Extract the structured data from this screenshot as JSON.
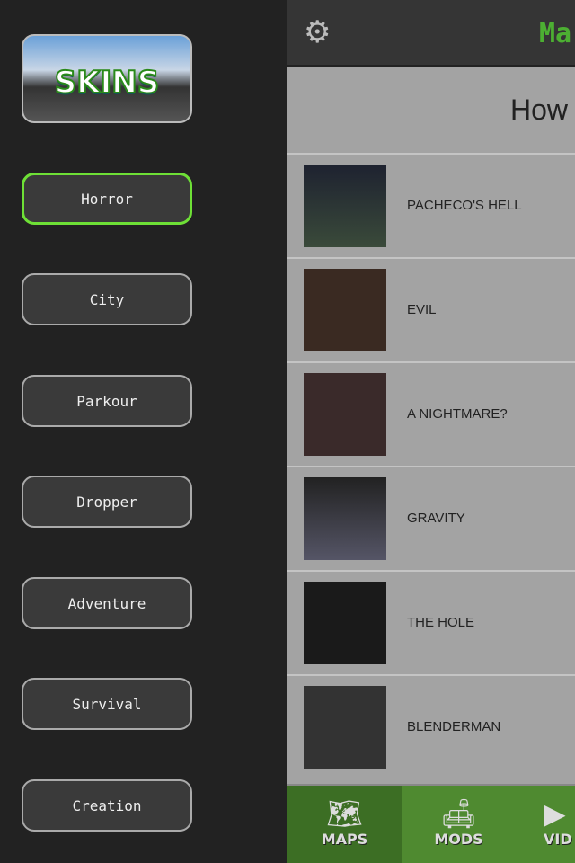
{
  "sidebar": {
    "logo_text": "SKINS",
    "categories": [
      {
        "label": "Horror",
        "active": true
      },
      {
        "label": "City"
      },
      {
        "label": "Parkour"
      },
      {
        "label": "Dropper"
      },
      {
        "label": "Adventure"
      },
      {
        "label": "Survival"
      },
      {
        "label": "Creation"
      }
    ]
  },
  "header": {
    "title": "Ma",
    "subheader": "How t"
  },
  "list": [
    {
      "name": "PACHECO'S HELL"
    },
    {
      "name": "EVIL"
    },
    {
      "name": "A NIGHTMARE?"
    },
    {
      "name": "GRAVITY"
    },
    {
      "name": "THE HOLE"
    },
    {
      "name": "BLENDERMAN"
    }
  ],
  "tabs": [
    {
      "label": "MAPS",
      "icon": "map-icon"
    },
    {
      "label": "MODS",
      "icon": "sofa-icon"
    },
    {
      "label": "VID",
      "icon": "play-icon"
    }
  ],
  "colors": {
    "accent": "#6ee036",
    "title": "#4caf32"
  }
}
